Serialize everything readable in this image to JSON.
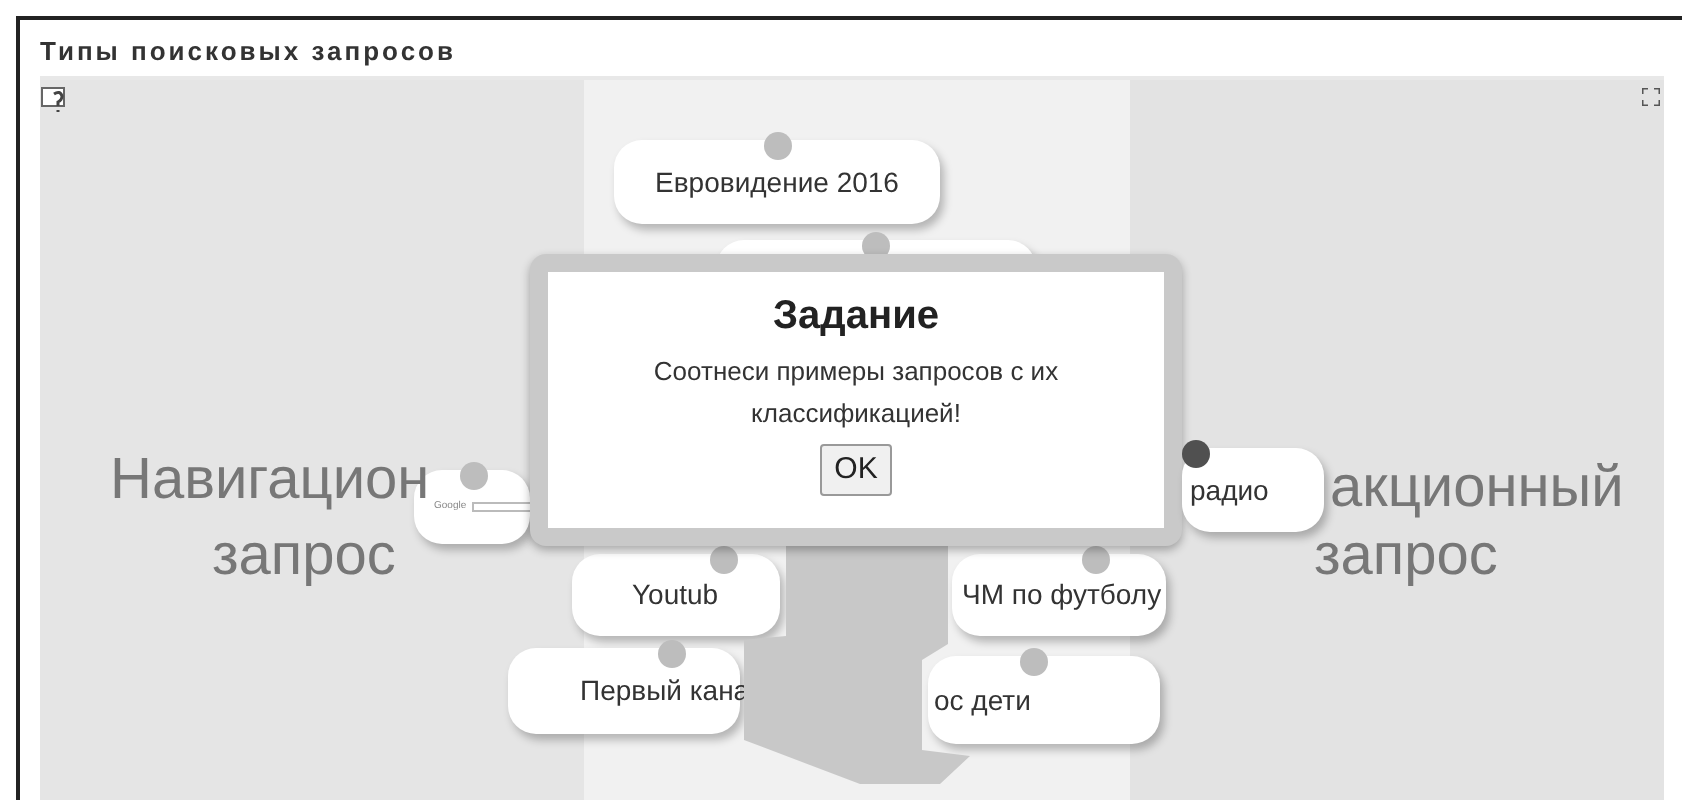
{
  "title": "Типы поисковых запросов",
  "categories": [
    {
      "lines": [
        "Навигацион",
        "запрос"
      ]
    },
    {
      "lines": [
        "акционный",
        "запрос"
      ]
    }
  ],
  "cards": [
    {
      "kind": "text",
      "text": "Евровидение 2016",
      "color": "#bdbdbd"
    },
    {
      "kind": "blank",
      "color": "#bdbdbd"
    },
    {
      "kind": "image",
      "text": "Google",
      "color": "#bdbdbd"
    },
    {
      "kind": "text",
      "text": "радио",
      "color": "#505050"
    },
    {
      "kind": "text",
      "text": "Youtub",
      "color": "#bdbdbd"
    },
    {
      "kind": "text",
      "text": "ЧМ по футболу",
      "color": "#bdbdbd"
    },
    {
      "kind": "text",
      "text": "Первый кана",
      "color": "#bdbdbd"
    },
    {
      "kind": "text",
      "text": "ос дети",
      "color": "#bdbdbd"
    }
  ],
  "dialog": {
    "title": "Задание",
    "message": "Соотнеси примеры запросов с их классификацией!",
    "button": "OK"
  }
}
